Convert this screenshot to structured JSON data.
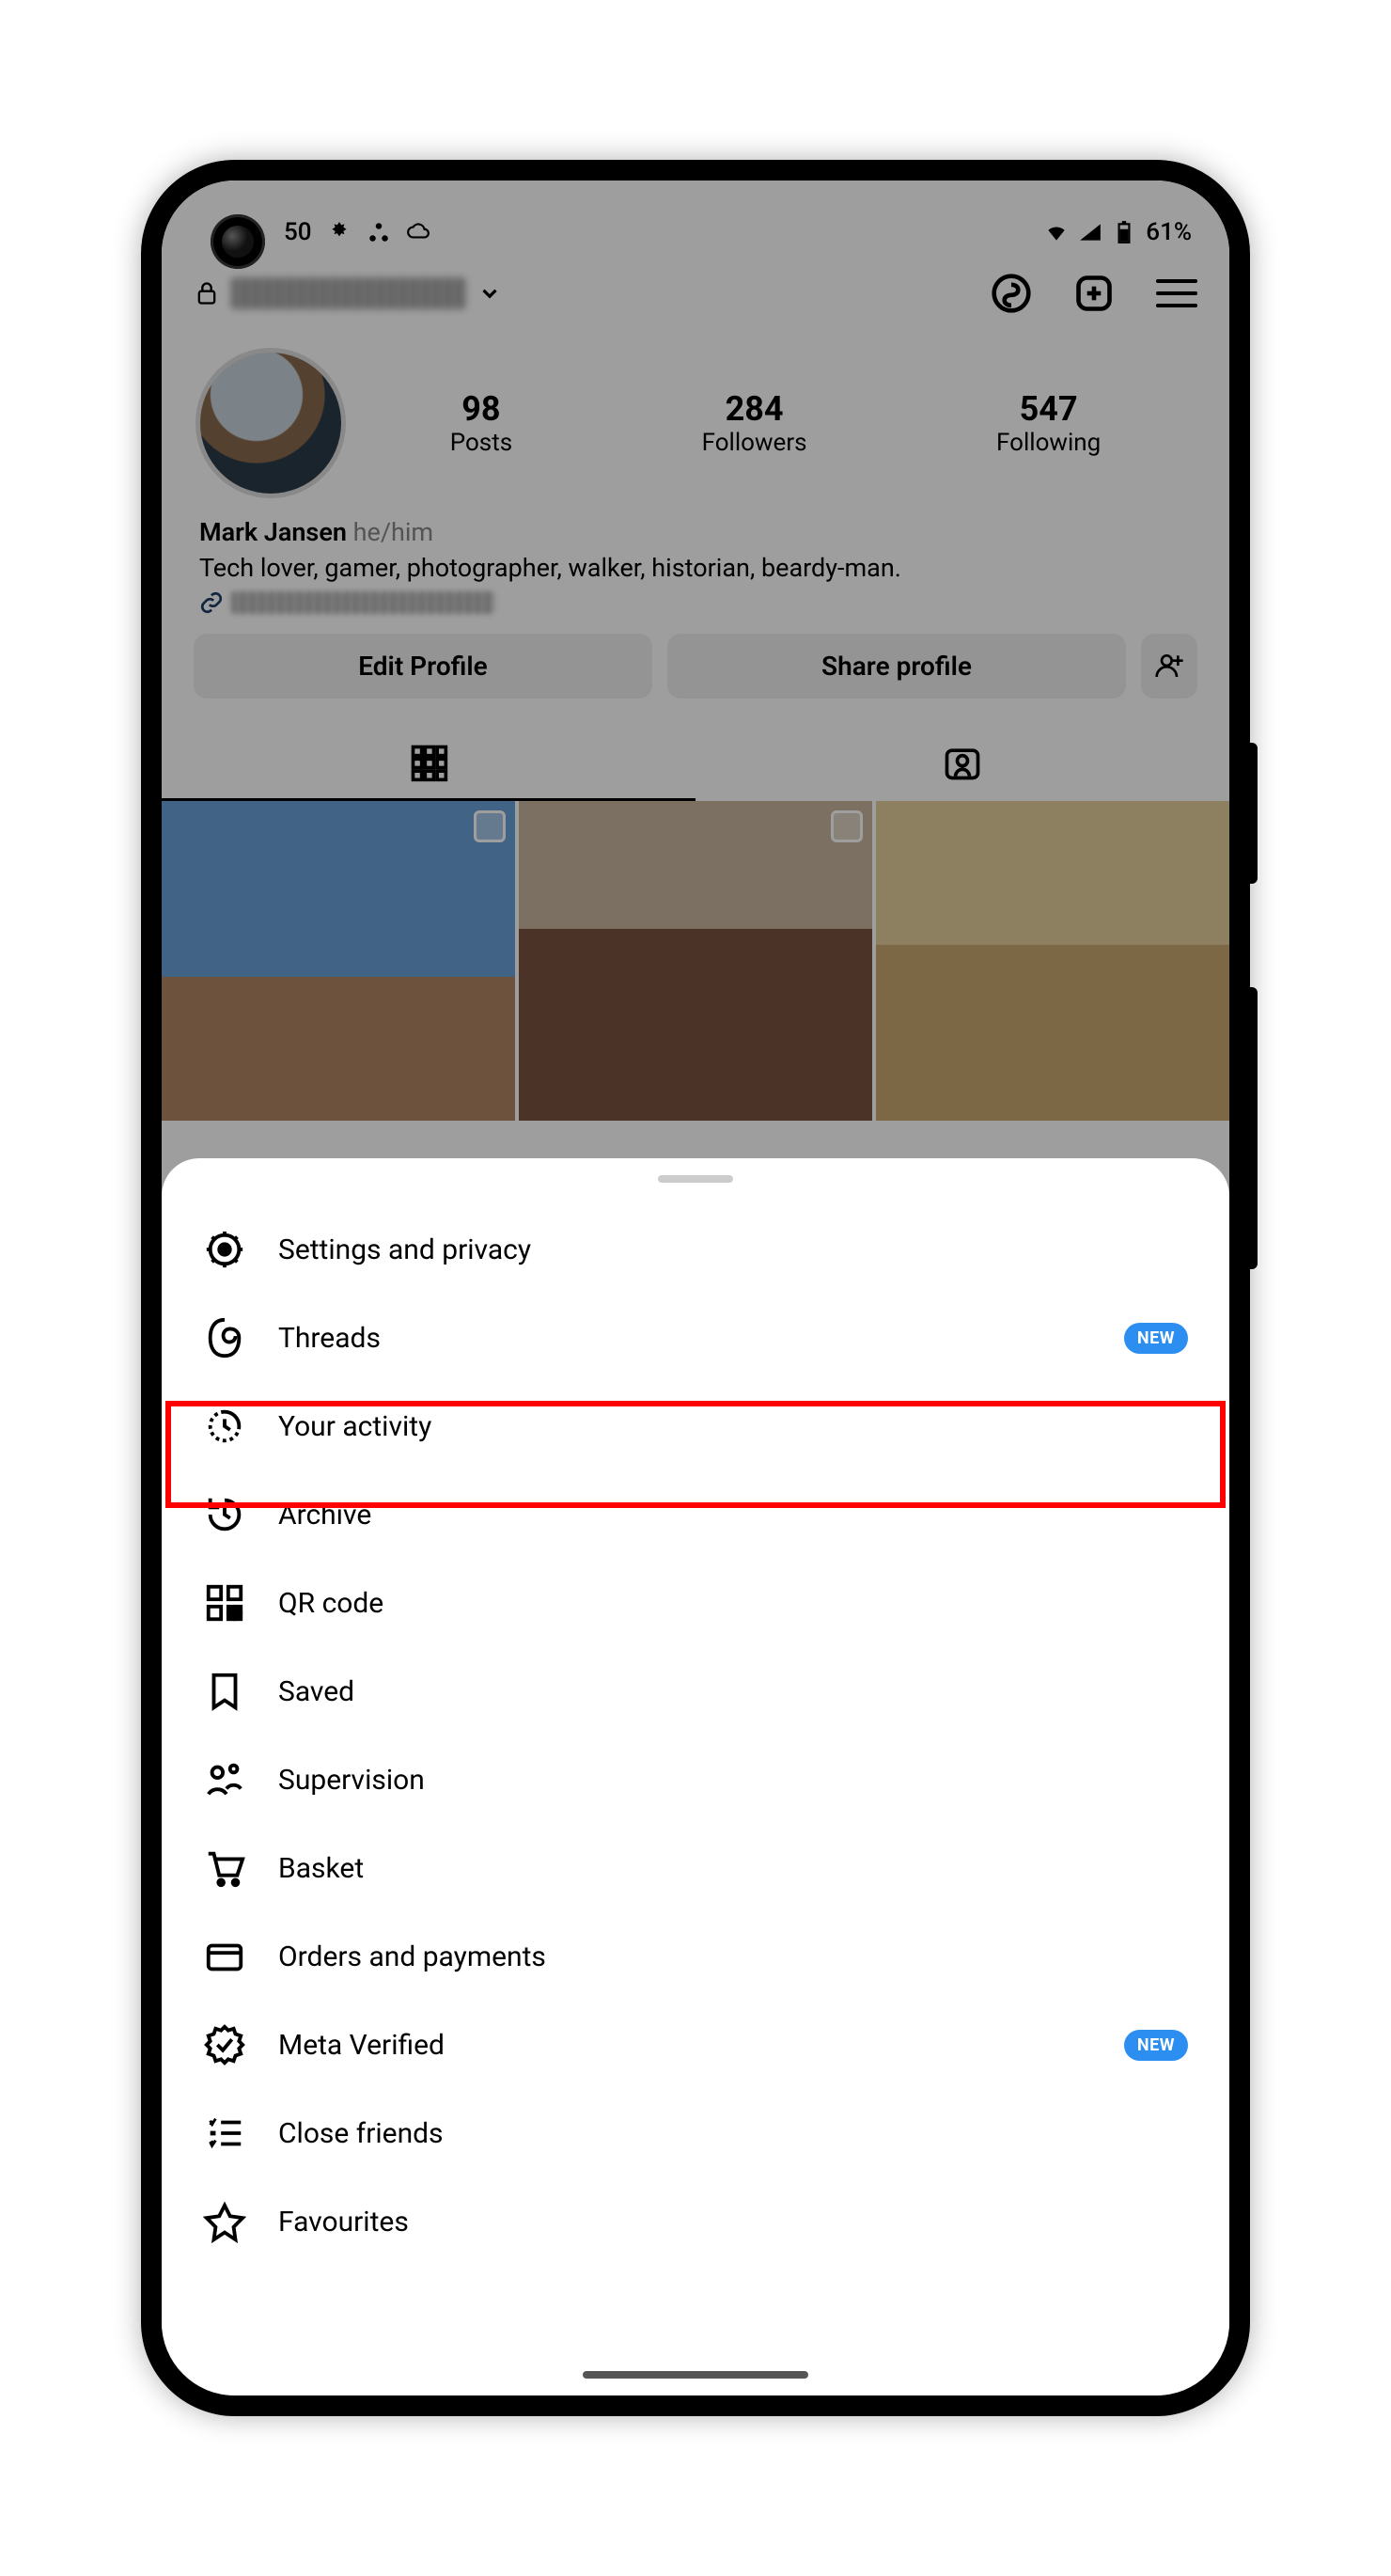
{
  "status_bar": {
    "time_suffix": "50",
    "battery_pct": "61%"
  },
  "profile": {
    "name": "Mark Jansen",
    "pronouns": "he/him",
    "bio": "Tech lover, gamer, photographer, walker, historian, beardy-man.",
    "stats": {
      "posts_count": "98",
      "posts_label": "Posts",
      "followers_count": "284",
      "followers_label": "Followers",
      "following_count": "547",
      "following_label": "Following"
    },
    "buttons": {
      "edit": "Edit Profile",
      "share": "Share profile"
    }
  },
  "menu": {
    "badge_text": "NEW",
    "items": [
      {
        "label": "Settings and privacy"
      },
      {
        "label": "Threads",
        "badge": true
      },
      {
        "label": "Your activity"
      },
      {
        "label": "Archive"
      },
      {
        "label": "QR code"
      },
      {
        "label": "Saved"
      },
      {
        "label": "Supervision"
      },
      {
        "label": "Basket"
      },
      {
        "label": "Orders and payments"
      },
      {
        "label": "Meta Verified",
        "badge": true
      },
      {
        "label": "Close friends"
      },
      {
        "label": "Favourites"
      }
    ]
  }
}
